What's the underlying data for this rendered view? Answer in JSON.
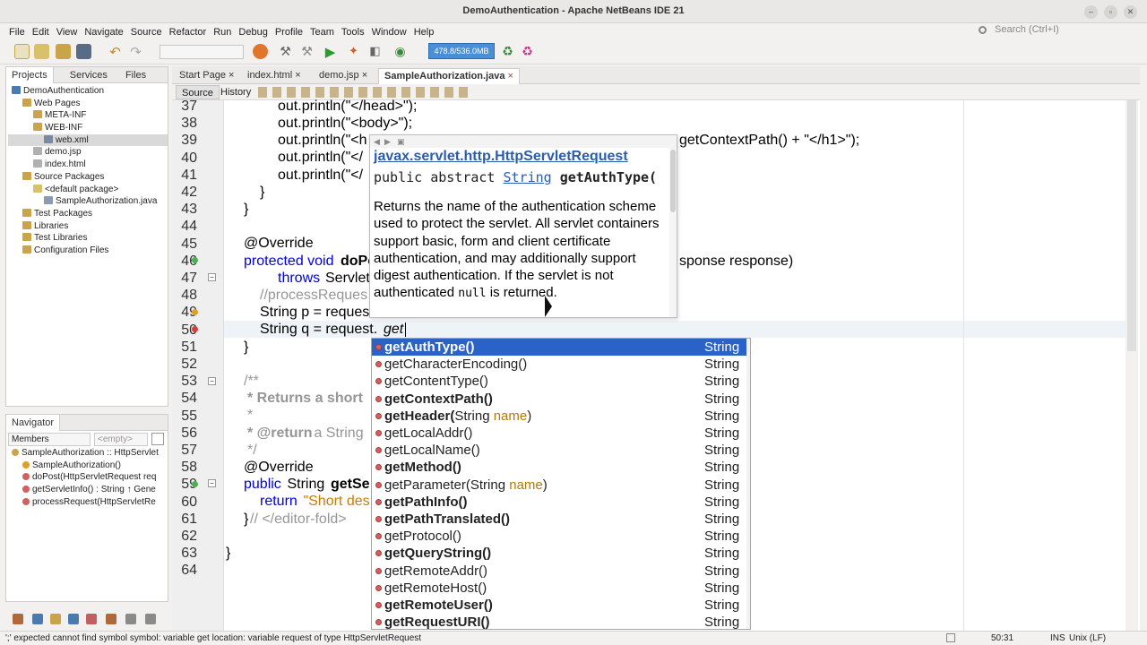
{
  "window": {
    "title": "DemoAuthentication - Apache NetBeans IDE 21"
  },
  "menu": [
    "File",
    "Edit",
    "View",
    "Navigate",
    "Source",
    "Refactor",
    "Run",
    "Debug",
    "Profile",
    "Team",
    "Tools",
    "Window",
    "Help"
  ],
  "search": {
    "placeholder": "Search (Ctrl+I)"
  },
  "toolbar": {
    "memory": "478.8/536.0MB"
  },
  "projects_panel": {
    "tabs": [
      "Projects",
      "Services",
      "Files"
    ],
    "tree": [
      {
        "label": "DemoAuthentication",
        "depth": 0
      },
      {
        "label": "Web Pages",
        "depth": 1
      },
      {
        "label": "META-INF",
        "depth": 2
      },
      {
        "label": "WEB-INF",
        "depth": 2
      },
      {
        "label": "web.xml",
        "depth": 3
      },
      {
        "label": "demo.jsp",
        "depth": 2
      },
      {
        "label": "index.html",
        "depth": 2
      },
      {
        "label": "Source Packages",
        "depth": 1
      },
      {
        "label": "<default package>",
        "depth": 2
      },
      {
        "label": "SampleAuthorization.java",
        "depth": 3
      },
      {
        "label": "Test Packages",
        "depth": 1
      },
      {
        "label": "Libraries",
        "depth": 1
      },
      {
        "label": "Test Libraries",
        "depth": 1
      },
      {
        "label": "Configuration Files",
        "depth": 1
      }
    ]
  },
  "navigator": {
    "title": "Navigator",
    "filter": "Members",
    "filter2": "<empty>",
    "items": [
      "SampleAuthorization :: HttpServlet",
      "SampleAuthorization()",
      "doPost(HttpServletRequest req",
      "getServletInfo() : String ↑ Gene",
      "processRequest(HttpServletRe"
    ]
  },
  "editor": {
    "tabs": [
      "Start Page",
      "index.html",
      "demo.jsp",
      "SampleAuthorization.java"
    ],
    "source_label": "Source",
    "history_label": "History",
    "line_numbers": [
      "37",
      "38",
      "39",
      "40",
      "41",
      "42",
      "43",
      "44",
      "45",
      "46",
      "47",
      "48",
      "49",
      "50",
      "51",
      "52",
      "53",
      "54",
      "55",
      "56",
      "57",
      "58",
      "59",
      "60",
      "61",
      "62",
      "63",
      "64"
    ],
    "lines": {
      "l37": "out.println(\"</head>\");",
      "l38": "out.println(\"<body>\");",
      "l39a": "out.println(\"<h",
      "l39b": "getContextPath() + \"</h1>\");",
      "l40": "out.println(\"</",
      "l41": "out.println(\"</",
      "l42": "}",
      "l43": "}",
      "l45": "@Override",
      "l46a": "protected void",
      "l46b": "doPo",
      "l46c": "sponse response)",
      "l47a": "throws",
      "l47b": "Servlet",
      "l48": "//processReques",
      "l49": "String p = reques",
      "l50a": "String q = request.",
      "l50b": "get",
      "l51": "}",
      "l53": "/**",
      "l54a": "* Returns a short",
      "l55": "*",
      "l56a": "* @return",
      "l56b": " a String",
      "l57": "*/",
      "l58": "@Override",
      "l59a": "public",
      "l59b": " String ",
      "l59c": "getSe",
      "l60a": "return",
      "l60b": " \"Short des",
      "l61a": "}",
      "l61b": "// </editor-fold>",
      "l63": "}"
    }
  },
  "doc_popup": {
    "class_name": "javax.servlet.http.HttpServletRequest",
    "sig_prefix": "public abstract ",
    "sig_type": "String",
    "sig_method": " getAuthType(",
    "body_text": "Returns the name of the authentication scheme used to protect the servlet. All servlet containers support basic, form and client certificate authentication, and may additionally support digest authentication. If the servlet is not authenticated ",
    "body_null": "null",
    "body_end": " is returned."
  },
  "completion": {
    "items": [
      {
        "name": "getAuthType()",
        "type": "String",
        "bold": true
      },
      {
        "name": "getCharacterEncoding()",
        "type": "String",
        "bold": false
      },
      {
        "name": "getContentType()",
        "type": "String",
        "bold": false
      },
      {
        "name": "getContextPath()",
        "type": "String",
        "bold": true
      },
      {
        "name": "getHeader(",
        "param_type": "String ",
        "param_name": "name",
        ")": "",
        "type": "String",
        "bold": true
      },
      {
        "name": "getLocalAddr()",
        "type": "String",
        "bold": false
      },
      {
        "name": "getLocalName()",
        "type": "String",
        "bold": false
      },
      {
        "name": "getMethod()",
        "type": "String",
        "bold": true
      },
      {
        "name": "getParameter(",
        "param_type": "String ",
        "param_name": "name",
        "type": "String",
        "bold": false
      },
      {
        "name": "getPathInfo()",
        "type": "String",
        "bold": true
      },
      {
        "name": "getPathTranslated()",
        "type": "String",
        "bold": true
      },
      {
        "name": "getProtocol()",
        "type": "String",
        "bold": false
      },
      {
        "name": "getQueryString()",
        "type": "String",
        "bold": true
      },
      {
        "name": "getRemoteAddr()",
        "type": "String",
        "bold": false
      },
      {
        "name": "getRemoteHost()",
        "type": "String",
        "bold": false
      },
      {
        "name": "getRemoteUser()",
        "type": "String",
        "bold": true
      },
      {
        "name": "getRequestURI()",
        "type": "String",
        "bold": true
      }
    ]
  },
  "status": {
    "message": "';' expected  cannot find symbol  symbol:  variable get  location: variable request of type HttpServletRequest",
    "position": "50:31",
    "mode": "INS",
    "line_ending": "Unix (LF)"
  },
  "colors": {
    "keyword": "#0000e6",
    "string": "#ce7b00",
    "comment": "#969696",
    "selection": "#2a62c8",
    "link": "#2a5db0"
  }
}
